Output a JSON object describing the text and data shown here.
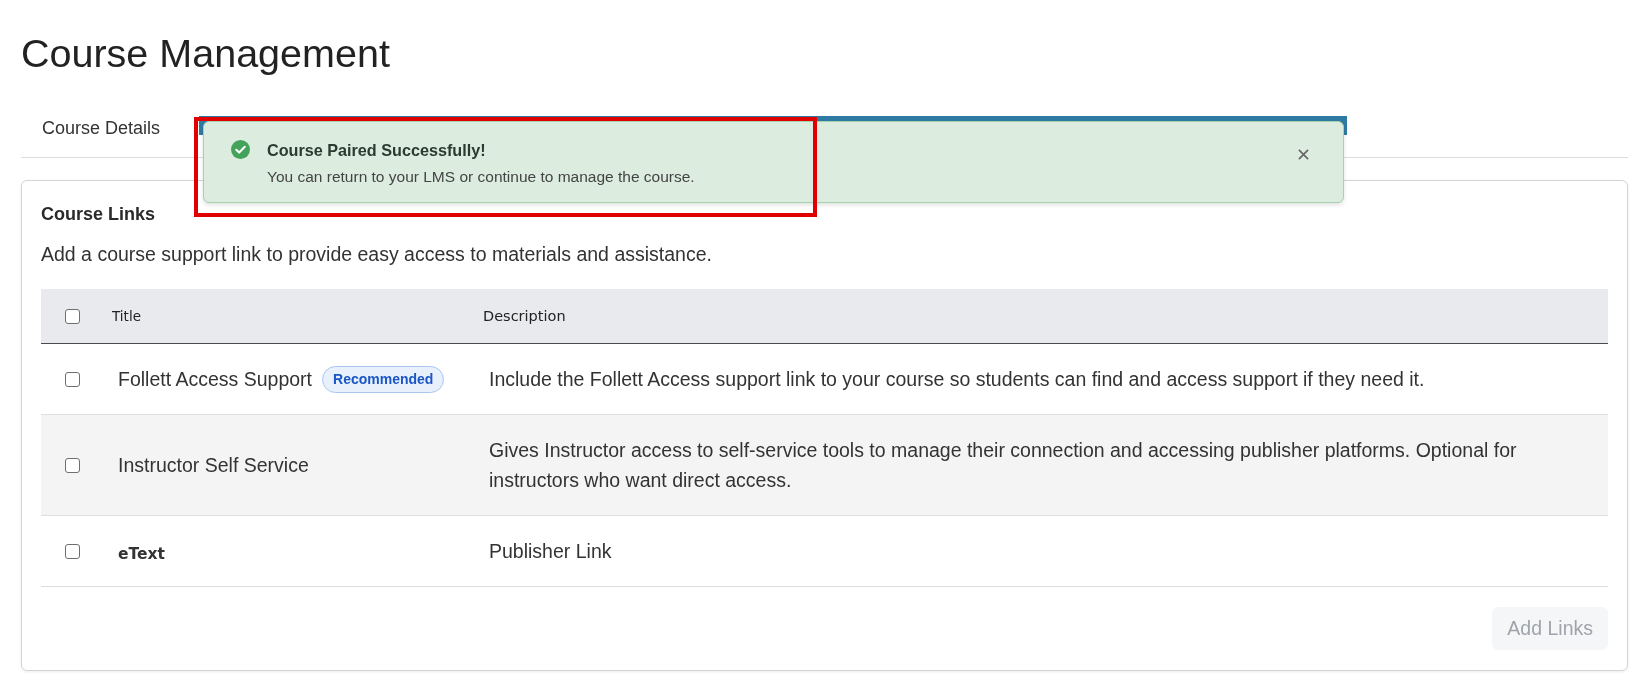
{
  "page": {
    "title": "Course Management"
  },
  "tabs": [
    {
      "label": "Course Details",
      "selected": false
    }
  ],
  "toast": {
    "title": "Course Paired Successfully!",
    "message": "You can return to your LMS or continue to manage the course."
  },
  "card": {
    "heading": "Course Links",
    "description": "Add a course support link to provide easy access to materials and assistance.",
    "table": {
      "columns": [
        "Title",
        "Description"
      ],
      "select_all_checked": false,
      "rows": [
        {
          "kind": "support",
          "title": "Follett Access Support",
          "badge": "Recommended",
          "description": "Include the Follett Access support link to your course so students can find and access support if they need it.",
          "checked": false
        },
        {
          "kind": "support",
          "title": "Instructor Self Service",
          "description": "Gives Instructor access to self-service tools to manage their connection and accessing publisher platforms. Optional for instructors who want direct access.",
          "checked": false
        },
        {
          "kind": "publisher",
          "title": "eText",
          "description": "Publisher Link",
          "checked": false
        }
      ]
    },
    "add_button": {
      "label": "Add Links",
      "disabled": true
    }
  }
}
